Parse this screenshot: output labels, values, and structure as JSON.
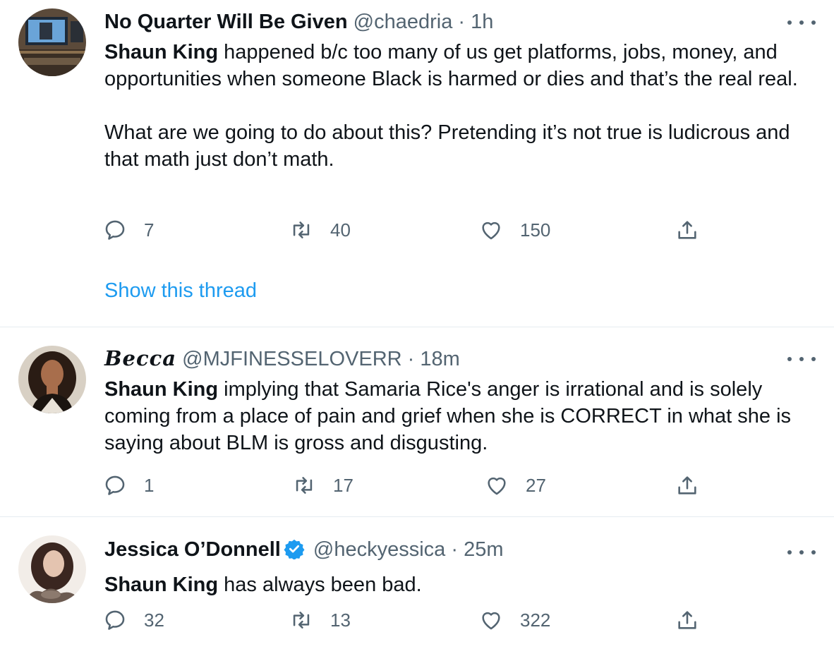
{
  "colors": {
    "link": "#1d9bf0",
    "secondary_text": "#536471",
    "primary_text": "#0f1419",
    "divider": "#e6ecf0",
    "verified_badge": "#1d9bf0"
  },
  "tweets": [
    {
      "display_name": "No Quarter Will Be Given",
      "handle": "@chaedria",
      "separator": "·",
      "time": "1h",
      "verified": false,
      "mention_bold": "Shaun King",
      "text_rest": " happened b/c too many of us get platforms, jobs, money, and opportunities when someone Black is harmed or dies and that’s the real real.",
      "text_para2": "What are we going to do about this? Pretending it’s not true is ludicrous and that math just don’t math.",
      "counts": {
        "replies": "7",
        "retweets": "40",
        "likes": "150"
      },
      "show_thread": "Show this thread",
      "icons": {
        "reply": "reply-icon",
        "retweet": "retweet-icon",
        "like": "heart-icon",
        "share": "share-icon",
        "more": "more-icon"
      }
    },
    {
      "display_name": "Becca",
      "handle": "@MJFINESSELOVERR",
      "separator": "·",
      "time": "18m",
      "verified": false,
      "mention_bold": "Shaun King",
      "text_rest": " implying that Samaria Rice's anger is irrational and is solely coming from a place of pain and grief when she is CORRECT in what she is saying about BLM is gross and disgusting.",
      "counts": {
        "replies": "1",
        "retweets": "17",
        "likes": "27"
      }
    },
    {
      "display_name": "Jessica O’Donnell",
      "handle": "@heckyessica",
      "separator": "·",
      "time": "25m",
      "verified": true,
      "mention_bold": "Shaun King",
      "text_rest": " has always been bad.",
      "counts": {
        "replies": "32",
        "retweets": "13",
        "likes": "322"
      }
    }
  ]
}
